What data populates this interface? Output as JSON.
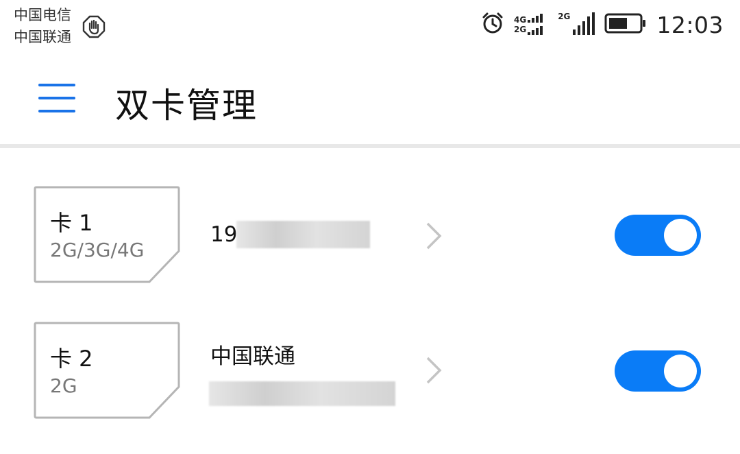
{
  "status_bar": {
    "carrier_1": "中国电信",
    "carrier_2": "中国联通",
    "network_1": "4G",
    "network_2": "2G",
    "network_3": "2G",
    "time": "12:03",
    "icons": [
      "hand-stop-icon",
      "alarm-icon",
      "signal-icon",
      "battery-icon"
    ]
  },
  "app_bar": {
    "title": "双卡管理",
    "menu_icon": "menu-icon"
  },
  "sims": [
    {
      "name": "卡 1",
      "network": "2G/3G/4G",
      "primary_text": "19",
      "enabled": true
    },
    {
      "name": "卡 2",
      "network": "2G",
      "primary_text": "中国联通",
      "enabled": true
    }
  ],
  "colors": {
    "accent": "#0a7cf7",
    "menu": "#1a73e8",
    "divider": "#e8e8e8",
    "card_border": "#b5b5b5"
  }
}
